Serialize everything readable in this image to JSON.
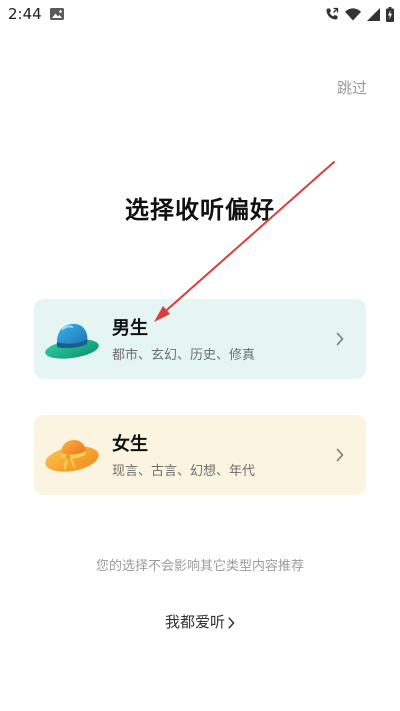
{
  "status_bar": {
    "time": "2:44",
    "icons": [
      "image-icon",
      "call-forward-icon",
      "wifi-icon",
      "cellular-signal-icon",
      "battery-charging-icon"
    ]
  },
  "skip_label": "跳过",
  "title": "选择收听偏好",
  "options": [
    {
      "title": "男生",
      "subtitle": "都市、玄幻、历史、修真",
      "icon": "green-hat-icon",
      "bg": "#e4f5f4"
    },
    {
      "title": "女生",
      "subtitle": "现言、古言、幻想、年代",
      "icon": "orange-sunhat-icon",
      "bg": "#fbf4e1"
    }
  ],
  "note": "您的选择不会影响其它类型内容推荐",
  "like_all_label": "我都爱听",
  "annotation": {
    "type": "red-arrow",
    "color": "#e03a3a",
    "points_to": "男生"
  }
}
